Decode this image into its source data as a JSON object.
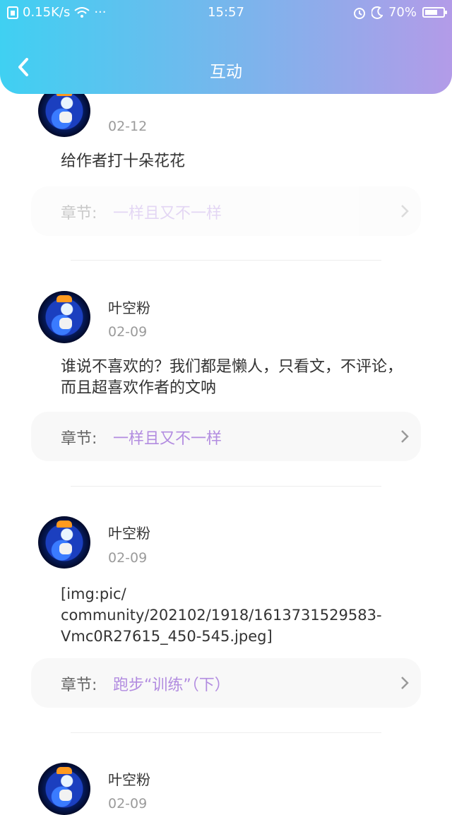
{
  "status_bar": {
    "speed": "0.15K/s",
    "more": "···",
    "time": "15:57",
    "battery": "70%",
    "battery_level": 0.7
  },
  "nav": {
    "title": "互动",
    "back_icon": "chevron-left-icon"
  },
  "comments": [
    {
      "name": "",
      "date": "02-12",
      "content": "给作者打十朵花花",
      "chapter_label": "章节:",
      "chapter_title": "一样且又不一样"
    },
    {
      "name": "叶空粉",
      "date": "02-09",
      "content": "谁说不喜欢的？我们都是懒人，只看文，不评论，而且超喜欢作者的文呐",
      "chapter_label": "章节:",
      "chapter_title": "一样且又不一样"
    },
    {
      "name": "叶空粉",
      "date": "02-09",
      "content": "[img:pic/\ncommunity/202102/1918/1613731529583-\nVmc0R27615_450-545.jpeg]",
      "chapter_label": "章节:",
      "chapter_title": "跑步“训练”（下）"
    },
    {
      "name": "叶空粉",
      "date": "02-09"
    }
  ],
  "colors": {
    "accent": "#b28ce0",
    "header_start": "#3fd0f2",
    "header_end": "#b39be8"
  }
}
